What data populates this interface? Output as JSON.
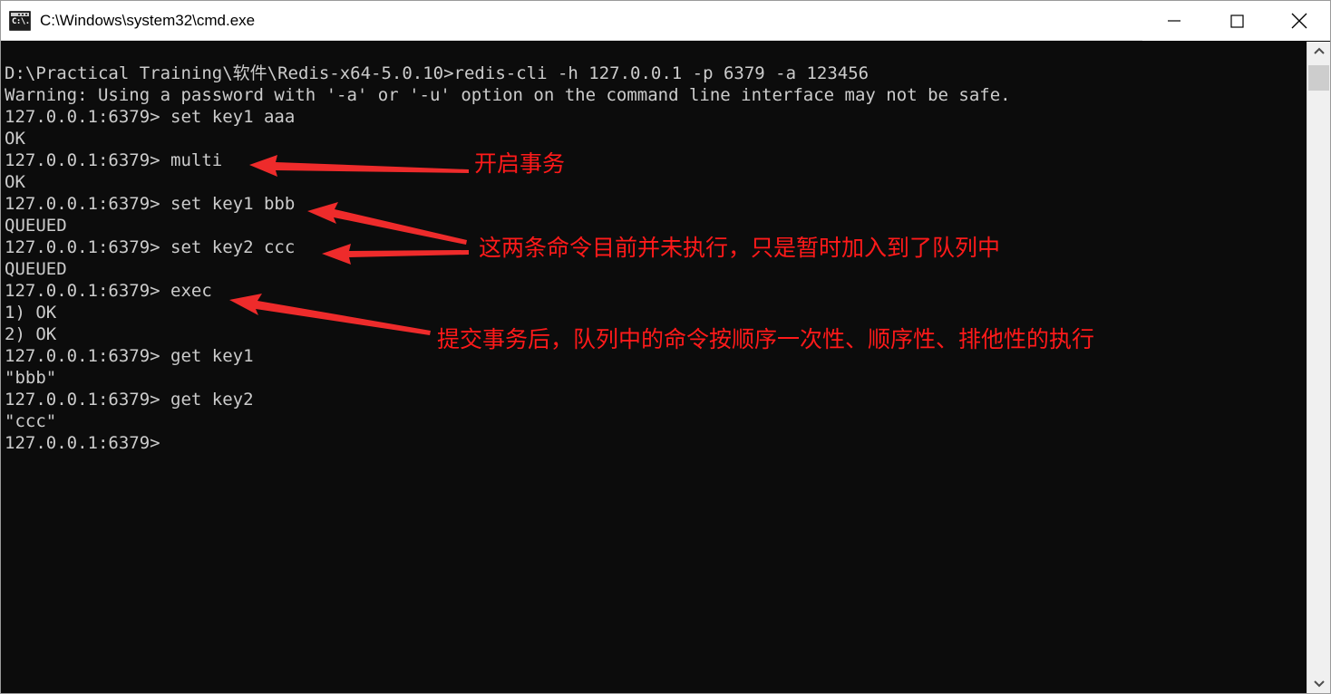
{
  "window": {
    "title": "C:\\Windows\\system32\\cmd.exe",
    "app_icon": "cmd-console-icon",
    "icon_glyph": "C:\\.",
    "controls": {
      "minimize": "minimize-button",
      "maximize": "maximize-button",
      "close": "close-button"
    },
    "background_color": "#0c0c0c",
    "titlebar_color": "#ffffff",
    "text_color": "#cccccc",
    "annotation_color": "#ff1a1a"
  },
  "console": {
    "lines": [
      "D:\\Practical Training\\软件\\Redis-x64-5.0.10>redis-cli -h 127.0.0.1 -p 6379 -a 123456",
      "Warning: Using a password with '-a' or '-u' option on the command line interface may not be safe.",
      "127.0.0.1:6379> set key1 aaa",
      "OK",
      "127.0.0.1:6379> multi",
      "OK",
      "127.0.0.1:6379> set key1 bbb",
      "QUEUED",
      "127.0.0.1:6379> set key2 ccc",
      "QUEUED",
      "127.0.0.1:6379> exec",
      "1) OK",
      "2) OK",
      "127.0.0.1:6379> get key1",
      "\"bbb\"",
      "127.0.0.1:6379> get key2",
      "\"ccc\"",
      "127.0.0.1:6379>"
    ]
  },
  "annotations": [
    {
      "id": "annotation-multi",
      "text": "开启事务"
    },
    {
      "id": "annotation-queued",
      "text": "这两条命令目前并未执行，只是暂时加入到了队列中"
    },
    {
      "id": "annotation-exec",
      "text": "提交事务后，队列中的命令按顺序一次性、顺序性、排他性的执行"
    }
  ],
  "scrollbar": {
    "up_arrow": "scroll-up-icon",
    "down_arrow": "scroll-down-icon",
    "thumb": "scrollbar-thumb"
  }
}
